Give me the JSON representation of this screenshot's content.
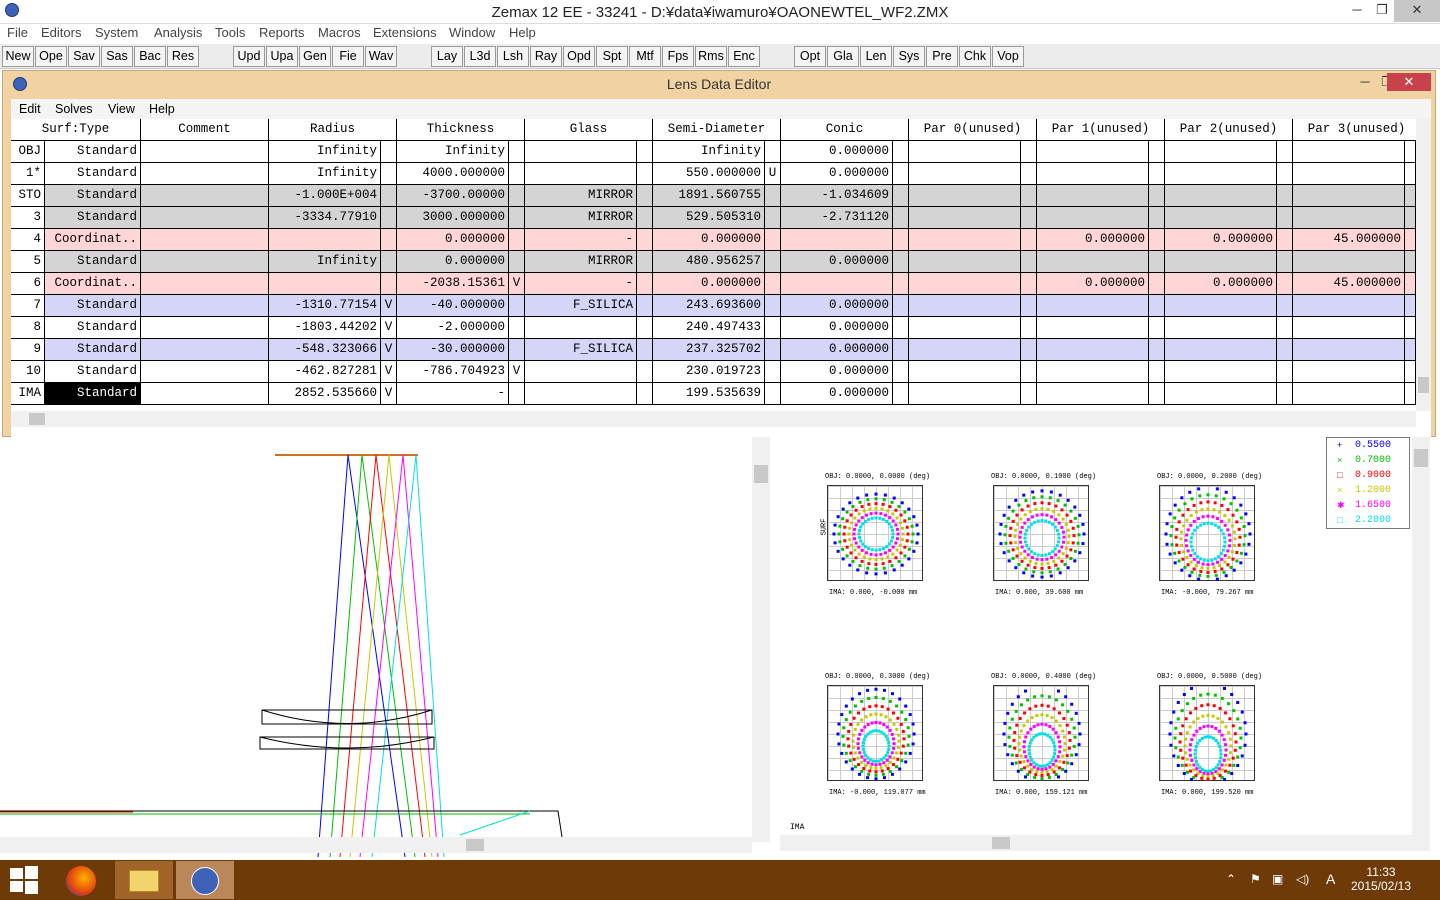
{
  "window": {
    "title": "Zemax 12 EE - 33241 - D:¥data¥iwamuro¥OAONEWTEL_WF2.ZMX",
    "min": "─",
    "max": "❐",
    "close": "✕"
  },
  "menu": [
    "File",
    "Editors",
    "System",
    "Analysis",
    "Tools",
    "Reports",
    "Macros",
    "Extensions",
    "Window",
    "Help"
  ],
  "toolbar": [
    "New",
    "Ope",
    "Sav",
    "Sas",
    "Bac",
    "Res",
    "Upd",
    "Upa",
    "Gen",
    "Fie",
    "Wav",
    "Lay",
    "L3d",
    "Lsh",
    "Ray",
    "Opd",
    "Spt",
    "Mtf",
    "Fps",
    "Rms",
    "Enc",
    "Opt",
    "Gla",
    "Len",
    "Sys",
    "Pre",
    "Chk",
    "Vop"
  ],
  "lde": {
    "title": "Lens Data Editor",
    "menu": [
      "Edit",
      "Solves",
      "View",
      "Help"
    ],
    "headers": [
      "Surf:Type",
      "Comment",
      "Radius",
      "Thickness",
      "Glass",
      "Semi-Diameter",
      "Conic",
      "Par 0(unused)",
      "Par 1(unused)",
      "Par 2(unused)",
      "Par 3(unused)"
    ],
    "rows": [
      {
        "surf": "OBJ",
        "type": "Standard",
        "comment": "",
        "radius": "Infinity",
        "rf": "",
        "thickness": "Infinity",
        "tf": "",
        "glass": "",
        "semi": "Infinity",
        "sf": "",
        "conic": "0.000000",
        "p1": "",
        "p2": "",
        "p3": "",
        "bg": "#ffffff"
      },
      {
        "surf": "1*",
        "type": "Standard",
        "comment": "",
        "radius": "Infinity",
        "rf": "",
        "thickness": "4000.000000",
        "tf": "",
        "glass": "",
        "semi": "550.000000",
        "sf": "U",
        "conic": "0.000000",
        "p1": "",
        "p2": "",
        "p3": "",
        "bg": "#ffffff"
      },
      {
        "surf": "STO",
        "type": "Standard",
        "comment": "",
        "radius": "-1.000E+004",
        "rf": "",
        "thickness": "-3700.00000",
        "tf": "",
        "glass": "MIRROR",
        "semi": "1891.560755",
        "sf": "",
        "conic": "-1.034609",
        "p1": "",
        "p2": "",
        "p3": "",
        "bg": "#d4d4d4"
      },
      {
        "surf": "3",
        "type": "Standard",
        "comment": "",
        "radius": "-3334.77910",
        "rf": "",
        "thickness": "3000.000000",
        "tf": "",
        "glass": "MIRROR",
        "semi": "529.505310",
        "sf": "",
        "conic": "-2.731120",
        "p1": "",
        "p2": "",
        "p3": "",
        "bg": "#d4d4d4"
      },
      {
        "surf": "4",
        "type": "Coordinat..",
        "comment": "",
        "radius": "",
        "rf": "",
        "thickness": "0.000000",
        "tf": "",
        "glass": "-",
        "semi": "0.000000",
        "sf": "",
        "conic": "",
        "p1": "0.000000",
        "p2": "0.000000",
        "p3": "45.000000",
        "bg": "#ffd5d5"
      },
      {
        "surf": "5",
        "type": "Standard",
        "comment": "",
        "radius": "Infinity",
        "rf": "",
        "thickness": "0.000000",
        "tf": "",
        "glass": "MIRROR",
        "semi": "480.956257",
        "sf": "",
        "conic": "0.000000",
        "p1": "",
        "p2": "",
        "p3": "",
        "bg": "#d4d4d4"
      },
      {
        "surf": "6",
        "type": "Coordinat..",
        "comment": "",
        "radius": "",
        "rf": "",
        "thickness": "-2038.15361",
        "tf": "V",
        "glass": "-",
        "semi": "0.000000",
        "sf": "",
        "conic": "",
        "p1": "0.000000",
        "p2": "0.000000",
        "p3": "45.000000",
        "bg": "#ffd5d5"
      },
      {
        "surf": "7",
        "type": "Standard",
        "comment": "",
        "radius": "-1310.77154",
        "rf": "V",
        "thickness": "-40.000000",
        "tf": "",
        "glass": "F_SILICA",
        "semi": "243.693600",
        "sf": "",
        "conic": "0.000000",
        "p1": "",
        "p2": "",
        "p3": "",
        "bg": "#d5d5f7"
      },
      {
        "surf": "8",
        "type": "Standard",
        "comment": "",
        "radius": "-1803.44202",
        "rf": "V",
        "thickness": "-2.000000",
        "tf": "",
        "glass": "",
        "semi": "240.497433",
        "sf": "",
        "conic": "0.000000",
        "p1": "",
        "p2": "",
        "p3": "",
        "bg": "#ffffff"
      },
      {
        "surf": "9",
        "type": "Standard",
        "comment": "",
        "radius": "-548.323066",
        "rf": "V",
        "thickness": "-30.000000",
        "tf": "",
        "glass": "F_SILICA",
        "semi": "237.325702",
        "sf": "",
        "conic": "0.000000",
        "p1": "",
        "p2": "",
        "p3": "",
        "bg": "#d5d5f7"
      },
      {
        "surf": "10",
        "type": "Standard",
        "comment": "",
        "radius": "-462.827281",
        "rf": "V",
        "thickness": "-786.704923",
        "tf": "V",
        "glass": "",
        "semi": "230.019723",
        "sf": "",
        "conic": "0.000000",
        "p1": "",
        "p2": "",
        "p3": "",
        "bg": "#ffffff"
      },
      {
        "surf": "IMA",
        "type": "Standard",
        "comment": "",
        "radius": "2852.535660",
        "rf": "V",
        "thickness": "-",
        "tf": "",
        "glass": "",
        "semi": "199.535639",
        "sf": "",
        "conic": "0.000000",
        "p1": "",
        "p2": "",
        "p3": "",
        "bg": "#ffffff"
      }
    ]
  },
  "spot": {
    "legend": [
      {
        "label": "0.5500",
        "color": "#0000ff",
        "marker": "+"
      },
      {
        "label": "0.7000",
        "color": "#00c000",
        "marker": "×"
      },
      {
        "label": "0.9000",
        "color": "#ff0000",
        "marker": "□"
      },
      {
        "label": "1.2000",
        "color": "#c8c800",
        "marker": "×"
      },
      {
        "label": "1.6500",
        "color": "#ff00ff",
        "marker": "✱"
      },
      {
        "label": "2.2000",
        "color": "#00e0e0",
        "marker": "□"
      }
    ],
    "plots": [
      {
        "obj": "OBJ: 0.0000, 0.0000 (deg)",
        "ima": "IMA: 0.000, -0.000 mm"
      },
      {
        "obj": "OBJ: 0.0000, 0.1000 (deg)",
        "ima": "IMA: 0.000, 39.600 mm"
      },
      {
        "obj": "OBJ: 0.0000, 0.2000 (deg)",
        "ima": "IMA: -0.000, 79.267 mm"
      },
      {
        "obj": "OBJ: 0.0000, 0.3000 (deg)",
        "ima": "IMA: -0.000, 119.077 mm"
      },
      {
        "obj": "OBJ: 0.0000, 0.4000 (deg)",
        "ima": "IMA: 0.000, 159.121 mm"
      },
      {
        "obj": "OBJ: 0.0000, 0.5000 (deg)",
        "ima": "IMA: 0.000, 199.520 mm"
      }
    ],
    "surface_label": "IMA",
    "scale_label": "SURF"
  },
  "taskbar": {
    "time": "11:33",
    "date": "2015/02/13",
    "ime": "A"
  }
}
